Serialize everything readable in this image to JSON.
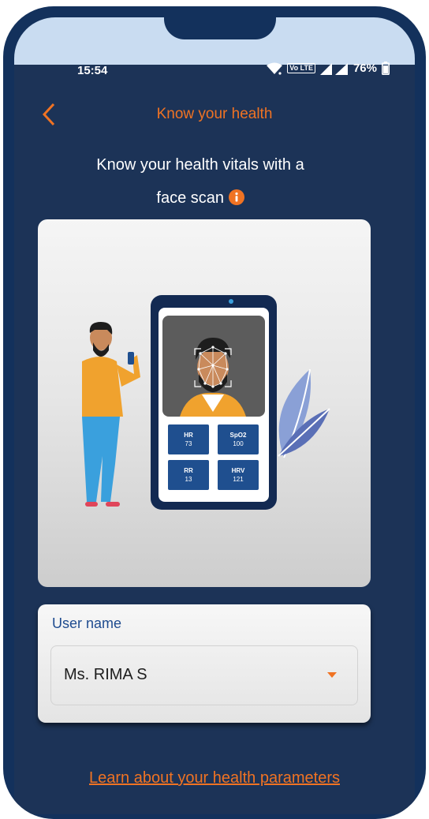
{
  "status_bar": {
    "time": "15:54",
    "network_badge": "Vo LTE",
    "battery_percent": "76%"
  },
  "header": {
    "title": "Know your health",
    "back_icon": "chevron-left-icon"
  },
  "subtitle": {
    "line1": "Know your health vitals with a",
    "line2": "face scan",
    "info_icon": "info-icon"
  },
  "illustration": {
    "vitals": [
      {
        "label": "HR",
        "value": "73"
      },
      {
        "label": "SpO2",
        "value": "100"
      },
      {
        "label": "RR",
        "value": "13"
      },
      {
        "label": "HRV",
        "value": "121"
      }
    ]
  },
  "user": {
    "label": "User name",
    "selected": "Ms. RIMA S"
  },
  "link": {
    "text": "Learn about your health parameters"
  },
  "colors": {
    "accent": "#f07323",
    "background": "#1c3357",
    "frame": "#13315c",
    "tile": "#1f4f8f"
  }
}
